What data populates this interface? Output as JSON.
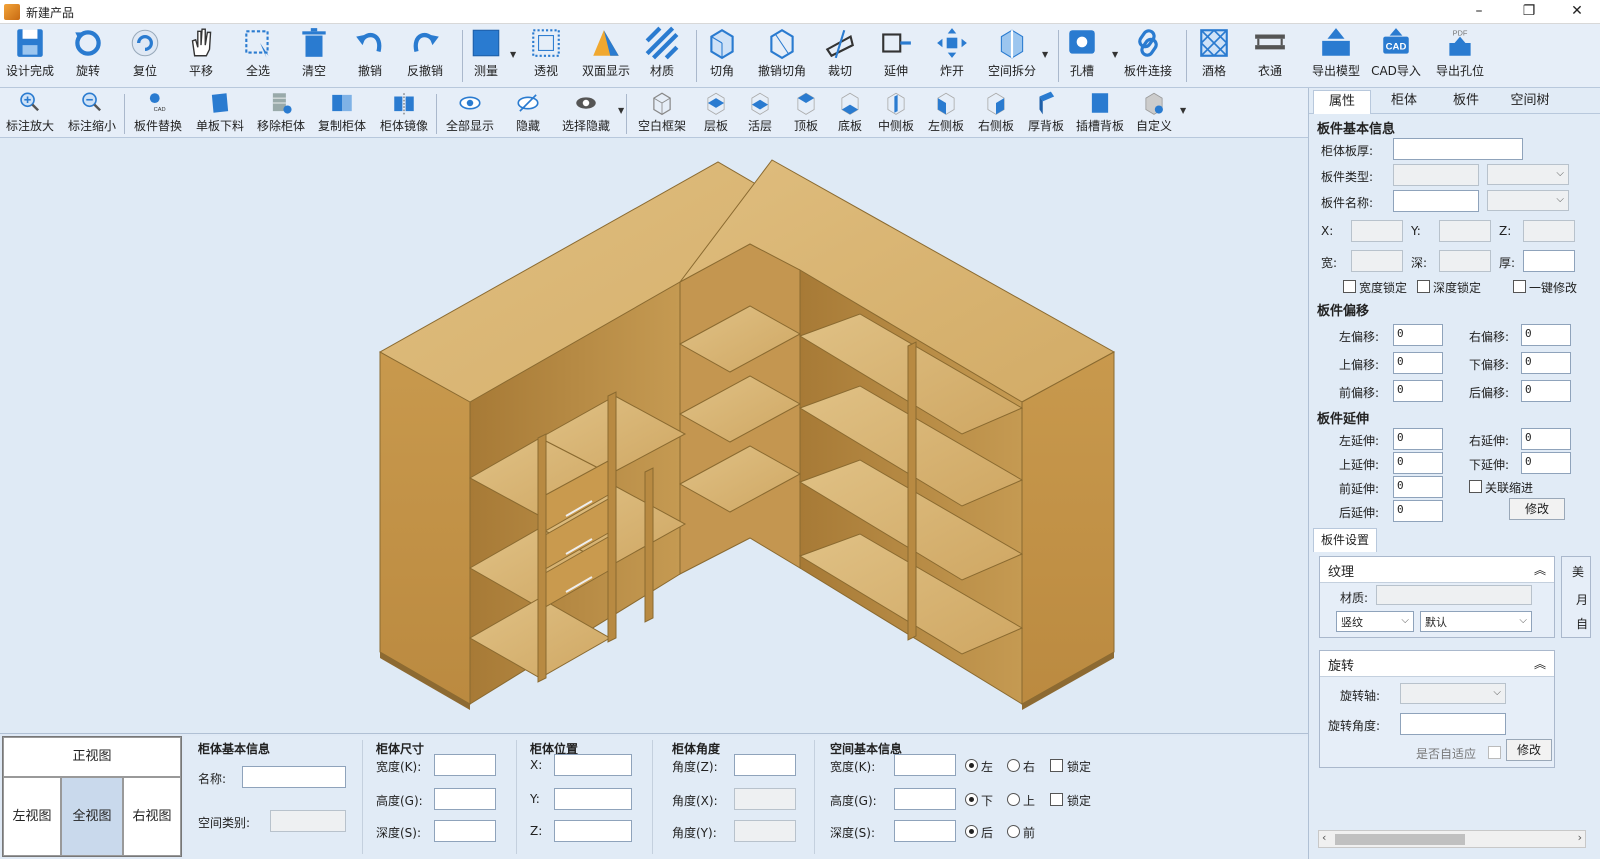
{
  "window": {
    "title": "新建产品",
    "minimize": "–",
    "restore": "❐",
    "close": "✕"
  },
  "toolbar1": [
    {
      "id": "design-done",
      "label": "设计完成",
      "icon": "save-icon"
    },
    {
      "id": "rotate",
      "label": "旋转",
      "icon": "rotate-icon"
    },
    {
      "id": "reset",
      "label": "复位",
      "icon": "reset-icon"
    },
    {
      "id": "pan",
      "label": "平移",
      "icon": "hand-icon"
    },
    {
      "id": "select-all",
      "label": "全选",
      "icon": "select-all-icon"
    },
    {
      "id": "clear",
      "label": "清空",
      "icon": "trash-icon"
    },
    {
      "id": "undo",
      "label": "撤销",
      "icon": "undo-icon"
    },
    {
      "id": "redo",
      "label": "反撤销",
      "icon": "redo-icon"
    },
    {
      "id": "measure",
      "label": "测量",
      "icon": "measure-icon"
    },
    {
      "id": "perspective",
      "label": "透视",
      "icon": "perspective-icon"
    },
    {
      "id": "double-side",
      "label": "双面显示",
      "icon": "double-side-icon"
    },
    {
      "id": "material",
      "label": "材质",
      "icon": "material-icon"
    },
    {
      "id": "cut-corner",
      "label": "切角",
      "icon": "cut-corner-icon"
    },
    {
      "id": "undo-cut-corner",
      "label": "撤销切角",
      "icon": "undo-cut-corner-icon"
    },
    {
      "id": "crop",
      "label": "裁切",
      "icon": "crop-icon"
    },
    {
      "id": "extend",
      "label": "延伸",
      "icon": "extend-icon"
    },
    {
      "id": "explode",
      "label": "炸开",
      "icon": "explode-icon"
    },
    {
      "id": "space-split",
      "label": "空间拆分",
      "icon": "space-split-icon"
    },
    {
      "id": "hole-slot",
      "label": "孔槽",
      "icon": "hole-slot-icon"
    },
    {
      "id": "panel-connect",
      "label": "板件连接",
      "icon": "link-icon"
    },
    {
      "id": "wine-grid",
      "label": "酒格",
      "icon": "wine-grid-icon"
    },
    {
      "id": "clothes-rail",
      "label": "衣通",
      "icon": "clothes-rail-icon"
    },
    {
      "id": "export-model",
      "label": "导出模型",
      "icon": "export-model-icon"
    },
    {
      "id": "cad-import",
      "label": "CAD导入",
      "icon": "cad-import-icon"
    },
    {
      "id": "export-holes",
      "label": "导出孔位",
      "icon": "pdf-export-icon"
    }
  ],
  "toolbar2": [
    {
      "id": "annot-zoom-in",
      "label": "标注放大",
      "icon": "zoom-in-icon"
    },
    {
      "id": "annot-zoom-out",
      "label": "标注缩小",
      "icon": "zoom-out-icon"
    },
    {
      "id": "panel-replace",
      "label": "板件替换",
      "icon": "panel-replace-icon"
    },
    {
      "id": "single-board",
      "label": "单板下料",
      "icon": "single-board-icon"
    },
    {
      "id": "remove-cabinet",
      "label": "移除柜体",
      "icon": "remove-cabinet-icon"
    },
    {
      "id": "copy-cabinet",
      "label": "复制柜体",
      "icon": "copy-cabinet-icon"
    },
    {
      "id": "mirror-cabinet",
      "label": "柜体镜像",
      "icon": "mirror-cabinet-icon"
    },
    {
      "id": "show-all",
      "label": "全部显示",
      "icon": "eye-icon"
    },
    {
      "id": "hide",
      "label": "隐藏",
      "icon": "eye-hidden-icon"
    },
    {
      "id": "select-hide",
      "label": "选择隐藏",
      "icon": "select-hide-icon"
    },
    {
      "id": "empty-frame",
      "label": "空白框架",
      "icon": "empty-frame-icon"
    },
    {
      "id": "shelf",
      "label": "层板",
      "icon": "shelf-icon"
    },
    {
      "id": "movable-shelf",
      "label": "活层",
      "icon": "movable-shelf-icon"
    },
    {
      "id": "top-panel",
      "label": "顶板",
      "icon": "top-panel-icon"
    },
    {
      "id": "bottom-panel",
      "label": "底板",
      "icon": "bottom-panel-icon"
    },
    {
      "id": "middle-side",
      "label": "中侧板",
      "icon": "middle-side-icon"
    },
    {
      "id": "left-side",
      "label": "左侧板",
      "icon": "left-side-icon"
    },
    {
      "id": "right-side",
      "label": "右侧板",
      "icon": "right-side-icon"
    },
    {
      "id": "thick-back",
      "label": "厚背板",
      "icon": "thick-back-icon"
    },
    {
      "id": "slot-back",
      "label": "插槽背板",
      "icon": "slot-back-icon"
    },
    {
      "id": "custom",
      "label": "自定义",
      "icon": "custom-icon"
    }
  ],
  "views": {
    "front": "正视图",
    "left": "左视图",
    "full": "全视图",
    "right": "右视图",
    "active": "full"
  },
  "cabinet_basic": {
    "title": "柜体基本信息",
    "name_label": "名称:",
    "name_value": "",
    "space_type_label": "空间类别:",
    "space_type_value": ""
  },
  "cabinet_size": {
    "title": "柜体尺寸",
    "width_label": "宽度(K):",
    "height_label": "高度(G):",
    "depth_label": "深度(S):",
    "width": "",
    "height": "",
    "depth": ""
  },
  "cabinet_position": {
    "title": "柜体位置",
    "x_label": "X:",
    "y_label": "Y:",
    "z_label": "Z:",
    "x": "",
    "y": "",
    "z": ""
  },
  "cabinet_angle": {
    "title": "柜体角度",
    "z_label": "角度(Z):",
    "x_label": "角度(X):",
    "y_label": "角度(Y):",
    "z": "",
    "x": "",
    "y": ""
  },
  "space_basic": {
    "title": "空间基本信息",
    "width_label": "宽度(K):",
    "height_label": "高度(G):",
    "depth_label": "深度(S):",
    "width": "",
    "height": "",
    "depth": "",
    "left": "左",
    "right": "右",
    "down": "下",
    "up": "上",
    "back": "后",
    "front": "前",
    "lock": "锁定"
  },
  "right_panel": {
    "tabs": [
      "属性",
      "柜体",
      "板件",
      "空间树"
    ],
    "active_tab": 0,
    "panel_basic": {
      "title": "板件基本信息",
      "thickness_label": "柜体板厚:",
      "type_label": "板件类型:",
      "name_label": "板件名称:",
      "x_label": "X:",
      "y_label": "Y:",
      "z_label": "Z:",
      "w_label": "宽:",
      "d_label": "深:",
      "t_label": "厚:",
      "width_lock": "宽度锁定",
      "depth_lock": "深度锁定",
      "one_key_edit": "一键修改"
    },
    "offset": {
      "title": "板件偏移",
      "left_label": "左偏移:",
      "right_label": "右偏移:",
      "top_label": "上偏移:",
      "bottom_label": "下偏移:",
      "front_label": "前偏移:",
      "back_label": "后偏移:",
      "left": "0",
      "right": "0",
      "top": "0",
      "bottom": "0",
      "front": "0",
      "back": "0"
    },
    "extension": {
      "title": "板件延伸",
      "left_label": "左延伸:",
      "right_label": "右延伸:",
      "top_label": "上延伸:",
      "bottom_label": "下延伸:",
      "front_label": "前延伸:",
      "back_label": "后延伸:",
      "left": "0",
      "right": "0",
      "top": "0",
      "bottom": "0",
      "front": "0",
      "back": "0",
      "link_indent": "关联缩进",
      "modify": "修改"
    },
    "settings_tab": "板件设置",
    "texture": {
      "title": "纹理",
      "material_label": "材质:",
      "material": "",
      "grain": "竖纹",
      "mode": "默认"
    },
    "rotation": {
      "title": "旋转",
      "axis_label": "旋转轴:",
      "angle_label": "旋转角度:",
      "auto_fit": "是否自适应",
      "modify": "修改"
    },
    "side_peek": {
      "a": "美",
      "b": "月",
      "c": "自"
    }
  },
  "colors": {
    "accent": "#2a7bd0",
    "wood_front": "#c99a4e",
    "wood_top": "#dcb877",
    "wood_side": "#b88a42",
    "viewport": "#dfeaf5",
    "active_view": "#c9d9ec"
  }
}
